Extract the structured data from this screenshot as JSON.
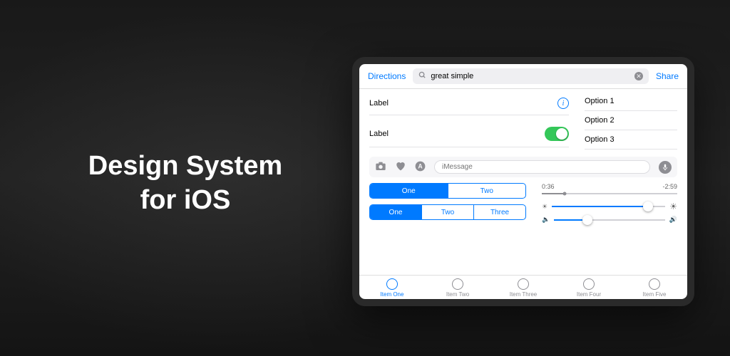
{
  "hero": {
    "line1": "Design System",
    "line2": "for iOS"
  },
  "navbar": {
    "left": "Directions",
    "right": "Share",
    "search_value": "great simple"
  },
  "rows": {
    "label1": "Label",
    "label2": "Label"
  },
  "options": [
    "Option 1",
    "Option 2",
    "Option 3"
  ],
  "imessage": {
    "placeholder": "iMessage"
  },
  "segments2": [
    "One",
    "Two"
  ],
  "segments3": [
    "One",
    "Two",
    "Three"
  ],
  "playback": {
    "elapsed": "0:36",
    "remaining": "-2:59",
    "position_pct": 17
  },
  "brightness": {
    "value_pct": 85
  },
  "volume": {
    "value_pct": 30
  },
  "tabs": [
    "Item One",
    "Item Two",
    "Item Three",
    "Item Four",
    "Item Five"
  ],
  "tab_selected": 0,
  "colors": {
    "accent": "#007aff",
    "success": "#34c759"
  }
}
